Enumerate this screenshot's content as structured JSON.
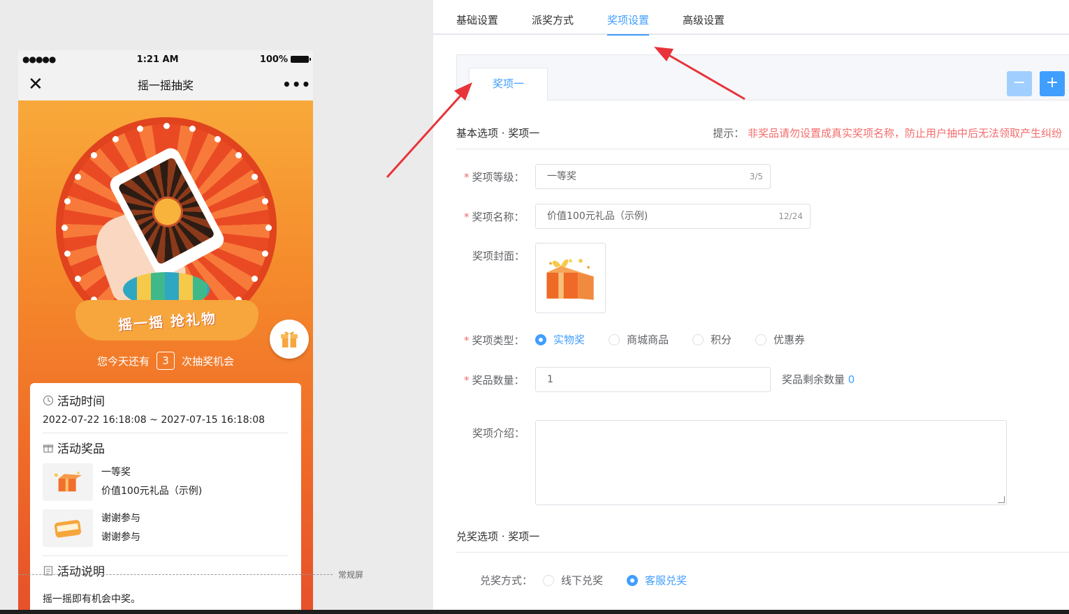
{
  "preview": {
    "status": {
      "signal": "●●●●●",
      "time": "1:21 AM",
      "battery": "100%"
    },
    "nav": {
      "close": "✕",
      "title": "摇一摇抽奖",
      "more": "•••"
    },
    "banner_text": "摇一摇 抢礼物",
    "chances": {
      "prefix": "您今天还有",
      "count": "3",
      "suffix": "次抽奖机会"
    },
    "activity_time": {
      "title": "活动时间",
      "range": "2022-07-22 16:18:08 ~ 2027-07-15 16:18:08"
    },
    "activity_prizes": {
      "title": "活动奖品",
      "items": [
        {
          "level": "一等奖",
          "name": "价值100元礼品（示例)"
        },
        {
          "level": "谢谢参与",
          "name": "谢谢参与"
        }
      ]
    },
    "activity_rules": {
      "title": "活动说明",
      "text": "摇一摇即有机会中奖。"
    },
    "screen_label": "常规屏"
  },
  "settings": {
    "tabs": [
      "基础设置",
      "派奖方式",
      "奖项设置",
      "高级设置"
    ],
    "active_tab": "奖项设置",
    "award_tab": "奖项一",
    "minus_label": "−",
    "plus_label": "+",
    "basic_section": {
      "title": "基本选项 · 奖项一",
      "tip_label": "提示：",
      "tip_text": "非奖品请勿设置成真实奖项名称，防止用户抽中后无法领取产生纠纷"
    },
    "fields": {
      "level": {
        "label": "奖项等级：",
        "value": "一等奖",
        "counter": "3/5"
      },
      "name": {
        "label": "奖项名称：",
        "value": "价值100元礼品（示例)",
        "counter": "12/24"
      },
      "cover": {
        "label": "奖项封面："
      },
      "type": {
        "label": "奖项类型：",
        "options": [
          "实物奖",
          "商城商品",
          "积分",
          "优惠券"
        ],
        "selected": "实物奖"
      },
      "quantity": {
        "label": "奖品数量：",
        "value": "1",
        "remain_label": "奖品剩余数量",
        "remain_value": "0"
      },
      "intro": {
        "label": "奖项介绍：",
        "value": ""
      }
    },
    "redeem_section": {
      "title": "兑奖选项 · 奖项一"
    },
    "redeem": {
      "label": "兑奖方式：",
      "options": [
        "线下兑奖",
        "客服兑奖"
      ],
      "selected": "客服兑奖"
    }
  },
  "colors": {
    "primary": "#409eff",
    "danger": "#f56c6c",
    "arrow": "#e8333a",
    "hero_orange": "#f5892b"
  }
}
